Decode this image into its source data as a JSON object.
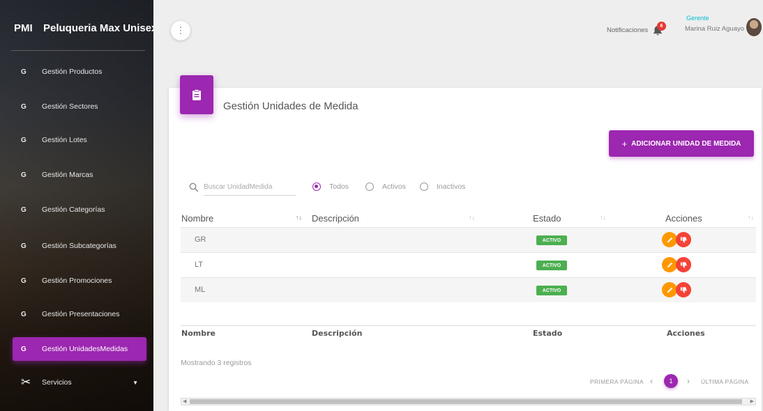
{
  "sidebar": {
    "brand_abbr": "PMI",
    "brand_name": "Peluqueria Max Unisex",
    "items": [
      {
        "letter": "G",
        "label": "Gestión Productos"
      },
      {
        "letter": "G",
        "label": "Gestión Sectores"
      },
      {
        "letter": "G",
        "label": "Gestión Lotes"
      },
      {
        "letter": "G",
        "label": "Gestión Marcas"
      },
      {
        "letter": "G",
        "label": "Gestión Categorías"
      },
      {
        "letter": "G",
        "label": "Gestión Subcategorías"
      },
      {
        "letter": "G",
        "label": "Gestión Promociones"
      },
      {
        "letter": "G",
        "label": "Gestión Presentaciones"
      },
      {
        "letter": "G",
        "label": "Gestión UnidadesMedidas"
      }
    ],
    "active_index": 8,
    "services": {
      "icon": "scissors-icon",
      "label": "Servicios"
    }
  },
  "topbar": {
    "notifications_label": "Notificaciones",
    "notifications_count": "6",
    "role": "Gerente",
    "username": "Marina Ruiz Aguayo"
  },
  "card": {
    "title": "Gestión Unidades de Medida",
    "add_button": "ADICIONAR UNIDAD DE MEDIDA",
    "search_placeholder": "Buscar UnidadMedida",
    "filters": [
      {
        "label": "Todos",
        "selected": true
      },
      {
        "label": "Activos",
        "selected": false
      },
      {
        "label": "Inactivos",
        "selected": false
      }
    ]
  },
  "table": {
    "headers": [
      "Nombre",
      "Descripción",
      "Estado",
      "Acciones"
    ],
    "rows": [
      {
        "nombre": "GR",
        "descripcion": "",
        "estado": "ACTIVO"
      },
      {
        "nombre": "LT",
        "descripcion": "",
        "estado": "ACTIVO"
      },
      {
        "nombre": "ML",
        "descripcion": "",
        "estado": "ACTIVO"
      }
    ],
    "footer": [
      "Nombre",
      "Descripción",
      "Estado",
      "Acciones"
    ]
  },
  "pagination": {
    "showing": "Mostrando 3 registros",
    "first": "PRIMERA PÁGINA",
    "last": "ÚLTIMA PÁGINA",
    "current": "1"
  },
  "colors": {
    "accent": "#9c27b0",
    "active": "#4caf50",
    "edit": "#ff9800",
    "delete": "#f44336",
    "role": "#00bcd4"
  }
}
